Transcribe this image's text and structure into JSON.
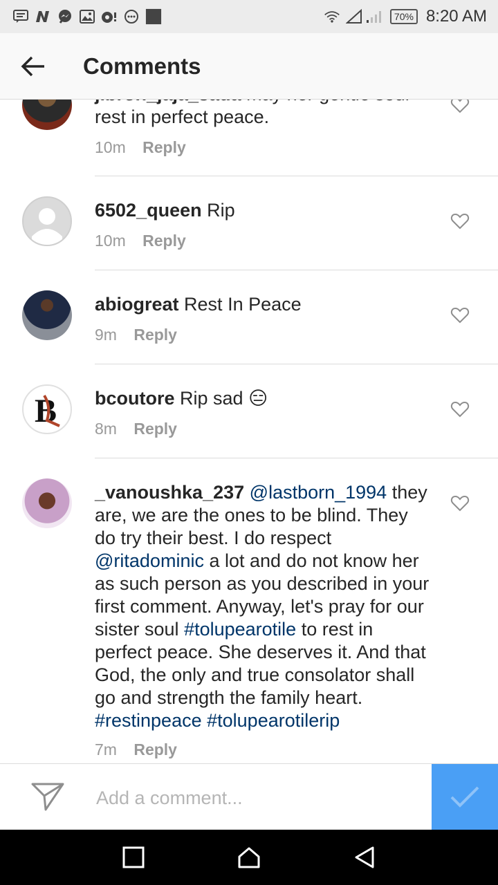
{
  "status_bar": {
    "battery": "70%",
    "time": "8:20 AM",
    "left_icons": [
      "message-icon",
      "n-app-icon",
      "messenger-icon",
      "image-icon",
      "music-icon",
      "more-icon",
      "app-square-icon"
    ],
    "right_icons": [
      "wifi-icon",
      "signal-icon",
      "battery-icon"
    ]
  },
  "header": {
    "title": "Comments"
  },
  "comments": [
    {
      "user": "jibron_jaja_sada",
      "text_line1": "may her gentle soul",
      "text_line2": "rest in perfect peace.",
      "time": "10m",
      "reply": "Reply"
    },
    {
      "user": "6502_queen",
      "text": "Rip",
      "time": "10m",
      "reply": "Reply"
    },
    {
      "user": "abiogreat",
      "text": "Rest In Peace",
      "time": "9m",
      "reply": "Reply"
    },
    {
      "user": "bcoutore",
      "text": "Rip sad",
      "emoji": "😑",
      "time": "8m",
      "reply": "Reply"
    },
    {
      "user": "_vanoushka_237",
      "mention1": "@lastborn_1994",
      "part1": "they are, we are the ones to be blind. They do try their best. I do respect",
      "mention2": "@ritadominic",
      "part2": "a lot and do not know her as such person as you described in your first comment. Anyway, let's pray for our sister soul",
      "tag1": "#tolupearotile",
      "part3": "to rest in perfect peace. She deserves it. And that God, the only and true consolator shall go and strength the family heart.",
      "tag2": "#restinpeace",
      "tag3": "#tolupearotilerip",
      "time": "7m",
      "reply": "Reply"
    }
  ],
  "composer": {
    "placeholder": "Add a comment..."
  },
  "colors": {
    "accent": "#4a9ff5",
    "link": "#003569",
    "meta": "#999999",
    "divider": "#dbdbdb"
  }
}
